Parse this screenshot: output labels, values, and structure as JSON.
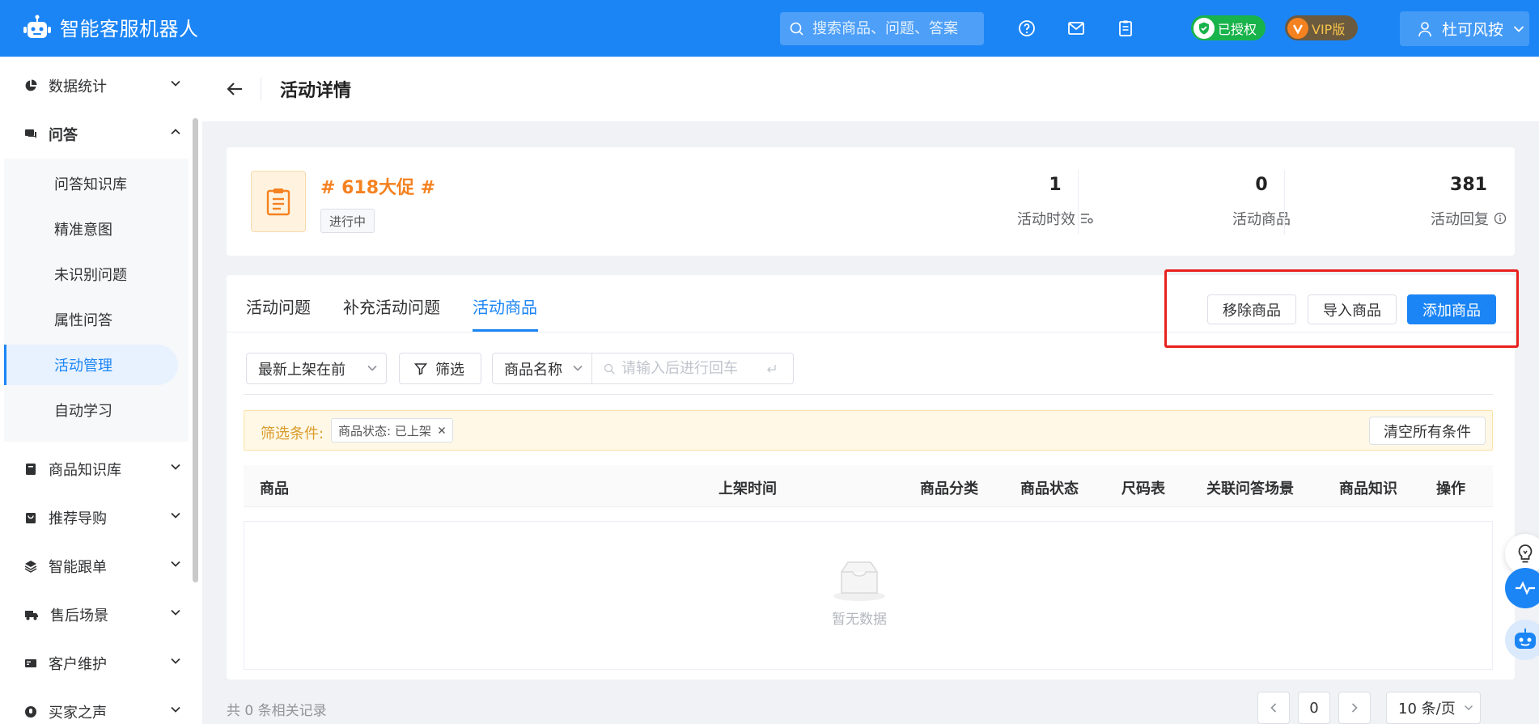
{
  "app": {
    "title": "智能客服机器人"
  },
  "search": {
    "placeholder": "搜索商品、问题、答案"
  },
  "badges": {
    "authorized": "已授权",
    "vip": "VIP版"
  },
  "user": {
    "name": "杜可风按"
  },
  "sidebar": {
    "groups": [
      {
        "label": "数据统计",
        "icon": "pie-chart-icon"
      },
      {
        "label": "问答",
        "icon": "chat-icon"
      },
      {
        "label": "商品知识库",
        "icon": "book-icon"
      },
      {
        "label": "推荐导购",
        "icon": "bag-icon"
      },
      {
        "label": "智能跟单",
        "icon": "layers-icon"
      },
      {
        "label": "售后场景",
        "icon": "truck-icon"
      },
      {
        "label": "客户维护",
        "icon": "card-icon"
      },
      {
        "label": "买家之声",
        "icon": "voice-icon"
      }
    ],
    "sub_items": [
      "问答知识库",
      "精准意图",
      "未识别问题",
      "属性问答",
      "活动管理",
      "自动学习"
    ]
  },
  "page": {
    "title": "活动详情"
  },
  "activity": {
    "name": "# 618大促 #",
    "status": "进行中",
    "stats": [
      {
        "value": "1",
        "label": "活动时效"
      },
      {
        "value": "0",
        "label": "活动商品"
      },
      {
        "value": "381",
        "label": "活动回复"
      }
    ]
  },
  "tabs": [
    "活动问题",
    "补充活动问题",
    "活动商品"
  ],
  "actions": {
    "remove": "移除商品",
    "import": "导入商品",
    "add": "添加商品"
  },
  "filters": {
    "sort": "最新上架在前",
    "filter_btn": "筛选",
    "field": "商品名称",
    "input_placeholder": "请输入后进行回车"
  },
  "conditions": {
    "label": "筛选条件:",
    "tag": "商品状态: 已上架",
    "clear": "清空所有条件"
  },
  "table": {
    "columns": [
      "商品",
      "上架时间",
      "商品分类",
      "商品状态",
      "尺码表",
      "关联问答场景",
      "商品知识",
      "操作"
    ],
    "empty_text": "暂无数据"
  },
  "pagination": {
    "total_text": "共 0 条相关记录",
    "page": "0",
    "page_size": "10 条/页"
  },
  "colors": {
    "primary": "#1b85f5",
    "accent_orange": "#f58220",
    "highlight_red": "#e8211e"
  }
}
